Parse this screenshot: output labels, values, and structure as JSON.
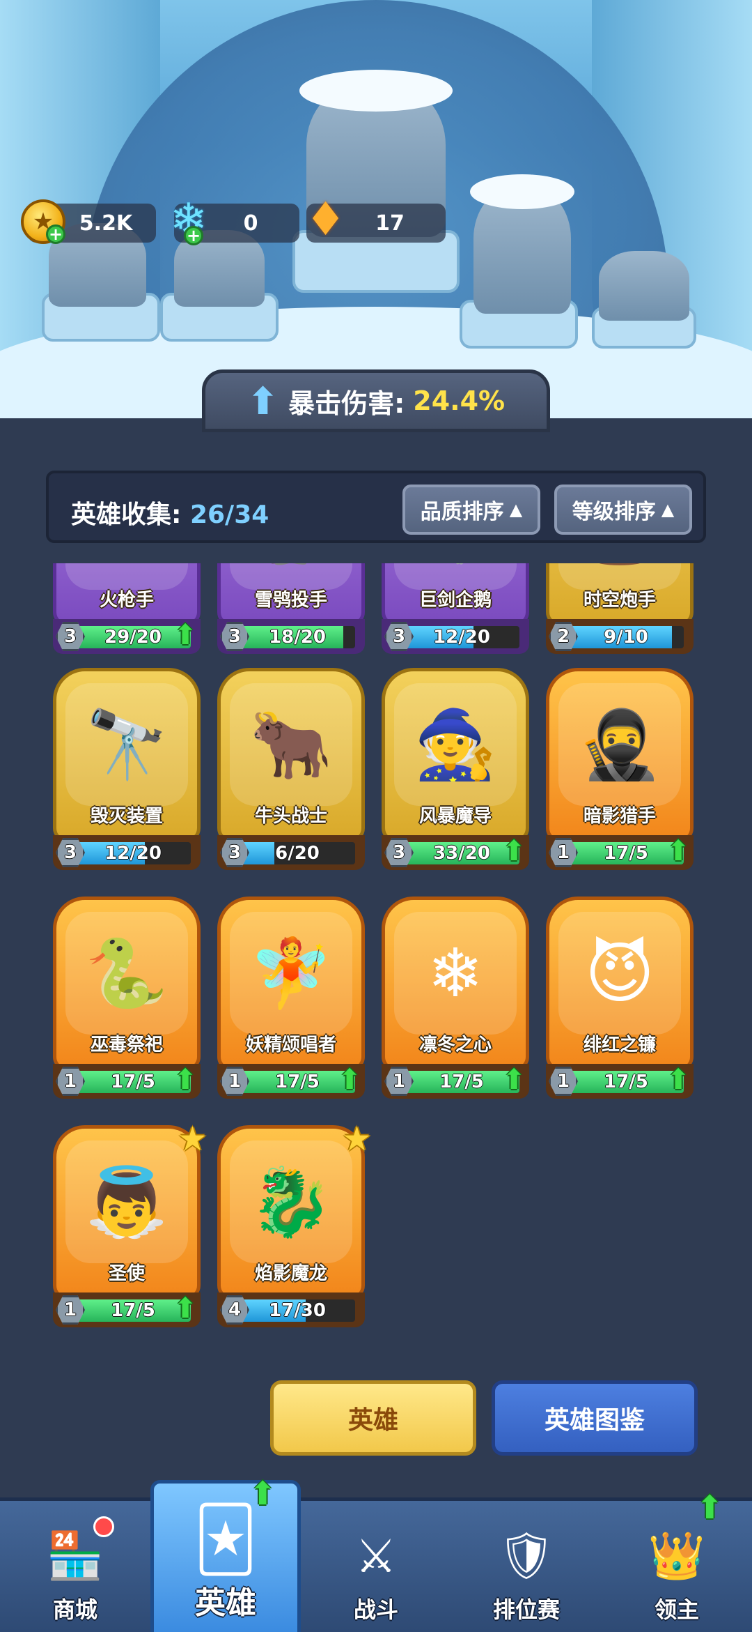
{
  "resources": {
    "gold": "5.2K",
    "gems": "0",
    "shards": "17"
  },
  "crit": {
    "label": "暴击伤害:",
    "value": "24.4%"
  },
  "collection": {
    "label": "英雄收集:",
    "count": "26/34",
    "sort_quality": "品质排序",
    "sort_level": "等级排序",
    "sort_arrow": "▲"
  },
  "heroes": [
    {
      "name": "火枪手",
      "level": "3",
      "progress": "29/20",
      "fill": 1.0,
      "color": "green",
      "quality": "purple",
      "upgrade": true,
      "figure": "🔫"
    },
    {
      "name": "雪鸮投手",
      "level": "3",
      "progress": "18/20",
      "fill": 0.9,
      "color": "green",
      "quality": "purple",
      "upgrade": false,
      "figure": "🦉"
    },
    {
      "name": "巨剑企鹅",
      "level": "3",
      "progress": "12/20",
      "fill": 0.6,
      "color": "blue",
      "quality": "purple",
      "upgrade": false,
      "figure": "🐧"
    },
    {
      "name": "时空炮手",
      "level": "2",
      "progress": "9/10",
      "fill": 0.9,
      "color": "blue",
      "quality": "gold",
      "upgrade": false,
      "figure": "⏳"
    },
    {
      "name": "毁灭装置",
      "level": "3",
      "progress": "12/20",
      "fill": 0.6,
      "color": "blue",
      "quality": "gold",
      "upgrade": false,
      "figure": "🔭"
    },
    {
      "name": "牛头战士",
      "level": "3",
      "progress": "6/20",
      "fill": 0.3,
      "color": "blue",
      "quality": "gold",
      "upgrade": false,
      "figure": "🐂"
    },
    {
      "name": "风暴魔导",
      "level": "3",
      "progress": "33/20",
      "fill": 1.0,
      "color": "green",
      "quality": "gold",
      "upgrade": true,
      "figure": "🧙"
    },
    {
      "name": "暗影猎手",
      "level": "1",
      "progress": "17/5",
      "fill": 1.0,
      "color": "green",
      "quality": "orange",
      "upgrade": true,
      "figure": "🥷"
    },
    {
      "name": "巫毒祭祀",
      "level": "1",
      "progress": "17/5",
      "fill": 1.0,
      "color": "green",
      "quality": "orange",
      "upgrade": true,
      "figure": "🐍"
    },
    {
      "name": "妖精颂唱者",
      "level": "1",
      "progress": "17/5",
      "fill": 1.0,
      "color": "green",
      "quality": "orange",
      "upgrade": true,
      "figure": "🧚"
    },
    {
      "name": "凛冬之心",
      "level": "1",
      "progress": "17/5",
      "fill": 1.0,
      "color": "green",
      "quality": "orange",
      "upgrade": true,
      "figure": "❄"
    },
    {
      "name": "绯红之镰",
      "level": "1",
      "progress": "17/5",
      "fill": 1.0,
      "color": "green",
      "quality": "orange",
      "upgrade": true,
      "figure": "😈"
    },
    {
      "name": "圣使",
      "level": "1",
      "progress": "17/5",
      "fill": 1.0,
      "color": "green",
      "quality": "orange",
      "upgrade": true,
      "star": true,
      "figure": "👼"
    },
    {
      "name": "焰影魔龙",
      "level": "4",
      "progress": "17/30",
      "fill": 0.57,
      "color": "blue",
      "quality": "orange",
      "upgrade": false,
      "star": true,
      "figure": "🐉"
    }
  ],
  "actions": {
    "hero": "英雄",
    "codex": "英雄图鉴"
  },
  "nav": [
    {
      "label": "商城",
      "icon": "shop-icon",
      "glyph": "🏪",
      "active": false
    },
    {
      "label": "英雄",
      "icon": "hero-card-icon",
      "glyph": "🃏",
      "active": true
    },
    {
      "label": "战斗",
      "icon": "battle-icon",
      "glyph": "⚔",
      "active": false
    },
    {
      "label": "排位赛",
      "icon": "ranked-icon",
      "glyph": "🛡",
      "active": false
    },
    {
      "label": "领主",
      "icon": "lord-icon",
      "glyph": "👑",
      "active": false
    }
  ]
}
